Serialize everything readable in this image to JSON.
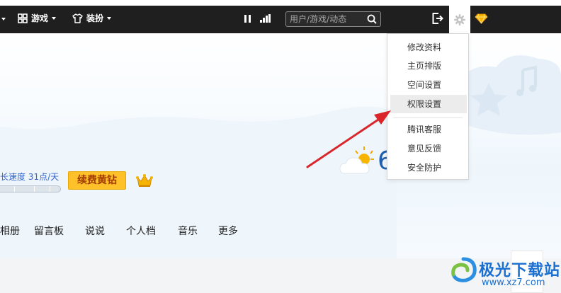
{
  "topbar": {
    "games_label": "游戏",
    "dressup_label": "装扮",
    "search_placeholder": "用户/游戏/动态"
  },
  "settings_menu": {
    "items": [
      {
        "label": "修改资料"
      },
      {
        "label": "主页排版"
      },
      {
        "label": "空间设置"
      },
      {
        "label": "权限设置"
      },
      {
        "label": "腾讯客服"
      },
      {
        "label": "意见反馈"
      },
      {
        "label": "安全防护"
      }
    ],
    "active_item": "权限设置"
  },
  "profile": {
    "speed_text": "长速度 31点/天",
    "renew_button": "续费黄钻",
    "temperature": "6"
  },
  "tabs": [
    {
      "label": "相册"
    },
    {
      "label": "留言板"
    },
    {
      "label": "说说"
    },
    {
      "label": "个人档"
    },
    {
      "label": "音乐"
    },
    {
      "label": "更多"
    }
  ],
  "watermark": {
    "name": "极光下载站",
    "url": "www.xz7.com"
  },
  "colors": {
    "topbar_bg": "#1f1f1f",
    "accent_gold": "#ffc12a",
    "arrow_red": "#d9262b",
    "link_blue": "#3366cc"
  }
}
